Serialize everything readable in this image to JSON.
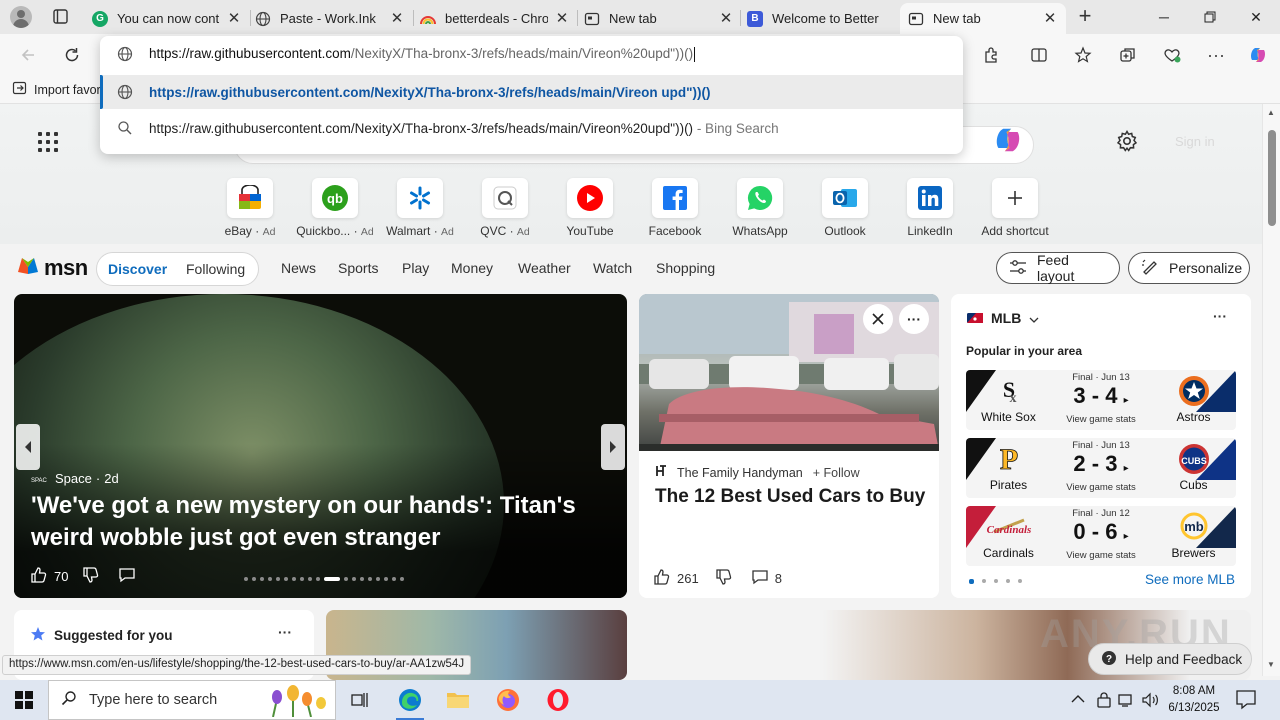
{
  "browser": {
    "tabs": [
      {
        "title": "You can now contin",
        "favicon": "grammarly-icon",
        "color": "#15a765"
      },
      {
        "title": "Paste - Work.Ink",
        "favicon": "globe-icon",
        "color": "#444444"
      },
      {
        "title": "betterdeals - Chron",
        "favicon": "rainbow-icon",
        "color": "#e05a2b"
      },
      {
        "title": "New tab",
        "favicon": "newtab-icon",
        "color": "#333333"
      },
      {
        "title": "Welcome to Better",
        "favicon": "betterdeals-icon",
        "color": "#3d5ad8"
      },
      {
        "title": "New tab",
        "favicon": "newtab-icon",
        "color": "#333333",
        "active": true
      }
    ],
    "omnibox": {
      "input_host": "https://raw.githubusercontent.com",
      "input_path": "/NexityX/Tha-bronx-3/refs/heads/main/Vireon%20upd\"))()",
      "suggestions": [
        {
          "text": "https://raw.githubusercontent.com/NexityX/Tha-bronx-3/refs/heads/main/Vireon upd\"))()",
          "type": "url"
        },
        {
          "text": "https://raw.githubusercontent.com/NexityX/Tha-bronx-3/refs/heads/main/Vireon%20upd\"))()",
          "suffix": " - Bing Search",
          "type": "search"
        }
      ]
    },
    "bookmark_bar": {
      "import_label": "Import favor"
    },
    "status_url": "https://www.msn.com/en-us/lifestyle/shopping/the-12-best-used-cars-to-buy/ar-AA1zw54J"
  },
  "ntp": {
    "signin_label": "Sign in",
    "shortcuts": [
      {
        "name": "eBay",
        "ad": "Ad",
        "icon": "ebay-icon"
      },
      {
        "name": "Quickbo...",
        "ad": "Ad",
        "icon": "quickbooks-icon"
      },
      {
        "name": "Walmart",
        "ad": "Ad",
        "icon": "walmart-icon"
      },
      {
        "name": "QVC",
        "ad": "Ad",
        "icon": "qvc-icon"
      },
      {
        "name": "YouTube",
        "ad": "",
        "icon": "youtube-icon"
      },
      {
        "name": "Facebook",
        "ad": "",
        "icon": "facebook-icon"
      },
      {
        "name": "WhatsApp",
        "ad": "",
        "icon": "whatsapp-icon"
      },
      {
        "name": "Outlook",
        "ad": "",
        "icon": "outlook-icon"
      },
      {
        "name": "LinkedIn",
        "ad": "",
        "icon": "linkedin-icon"
      },
      {
        "name": "Add shortcut",
        "ad": "",
        "icon": "plus-icon"
      }
    ]
  },
  "feed": {
    "logo": "msn",
    "pills": [
      "Discover",
      "Following"
    ],
    "nav": [
      "News",
      "Sports",
      "Play",
      "Money",
      "Weather",
      "Watch",
      "Shopping"
    ],
    "feed_layout_label": "Feed layout",
    "personalize_label": "Personalize",
    "hero": {
      "source": "Space",
      "age": "2d",
      "title": "'We've got a new mystery on our hands': Titan's weird wobble just got even stranger",
      "likes": "70"
    },
    "car_card": {
      "source": "The Family Handyman",
      "follow": "Follow",
      "title": "The 12 Best Used Cars to Buy",
      "likes": "261",
      "comments": "8"
    },
    "mlb": {
      "league": "MLB",
      "subtitle": "Popular in your area",
      "games": [
        {
          "status": "Final · Jun 13",
          "score": "3 - 4",
          "link": "View game stats",
          "away": "White Sox",
          "home": "Astros"
        },
        {
          "status": "Final · Jun 13",
          "score": "2 - 3",
          "link": "View game stats",
          "away": "Pirates",
          "home": "Cubs"
        },
        {
          "status": "Final · Jun 12",
          "score": "0 - 6",
          "link": "View game stats",
          "away": "Cardinals",
          "home": "Brewers"
        }
      ],
      "see_more": "See more MLB"
    },
    "suggested_label": "Suggested for you",
    "help_label": "Help and Feedback",
    "watermark": "ANY.RUN"
  },
  "taskbar": {
    "search_placeholder": "Type here to search",
    "time": "8:08 AM",
    "date": "6/13/2025"
  }
}
